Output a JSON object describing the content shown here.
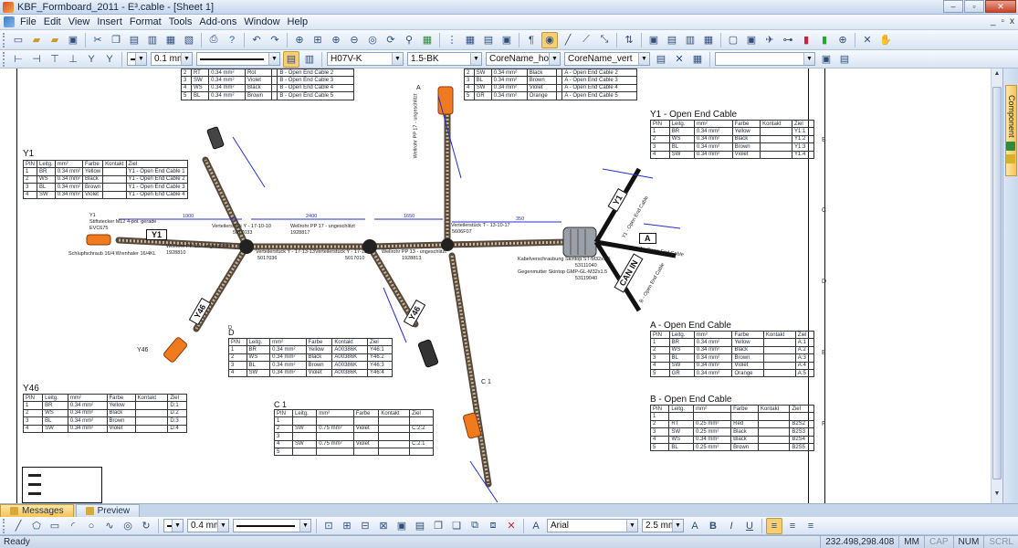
{
  "window": {
    "title": "KBF_Formboard_2011 - E³.cable - [Sheet 1]",
    "minimize": "–",
    "restore": "▫",
    "close": "✕"
  },
  "menu": {
    "items": [
      "File",
      "Edit",
      "View",
      "Insert",
      "Format",
      "Tools",
      "Add-ons",
      "Window",
      "Help"
    ],
    "mdi": [
      "_",
      "▫",
      "x"
    ]
  },
  "toolbar2": {
    "line_width": "0.1 mm",
    "cable_type": "H07V-K",
    "cable_section": "1.5-BK",
    "core_name_h": "CoreName_hori",
    "core_name_v": "CoreName_vert",
    "empty_combo": ""
  },
  "drawing": {
    "row_letters": [
      "B",
      "C",
      "D",
      "E",
      "F"
    ],
    "tables": {
      "header": [
        "PIN",
        "Leitg.",
        "mm²",
        "Farbe",
        "Kontakt",
        "Ziel"
      ],
      "top_left_partial": [
        [
          "2",
          "RT",
          "0.34 mm²",
          "Rot",
          "",
          "B - Open End Cable 2"
        ],
        [
          "3",
          "SW",
          "0.34 mm²",
          "Violet",
          "",
          "B - Open End Cable 3"
        ],
        [
          "4",
          "WS",
          "0.34 mm²",
          "Black",
          "",
          "B - Open End Cable 4"
        ],
        [
          "5",
          "BL",
          "0.34 mm²",
          "Brown",
          "",
          "B - Open End Cable 5"
        ]
      ],
      "top_mid_partial": [
        [
          "2",
          "SW",
          "0.34 mm²",
          "Black",
          "",
          "A - Open End Cable 2"
        ],
        [
          "3",
          "BL",
          "0.34 mm²",
          "Brown",
          "",
          "A - Open End Cable 3"
        ],
        [
          "4",
          "SW",
          "0.34 mm²",
          "Violet",
          "",
          "A - Open End Cable 4"
        ],
        [
          "5",
          "GR",
          "0.34 mm²",
          "Orange",
          "",
          "A - Open End Cable 5"
        ]
      ],
      "y1_left": {
        "title": "Y1",
        "rows": [
          [
            "1",
            "BR",
            "0.34 mm²",
            "Yellow",
            "",
            "Y1 - Open End Cable 1"
          ],
          [
            "2",
            "WS",
            "0.34 mm²",
            "Black",
            "",
            "Y1 - Open End Cable 2"
          ],
          [
            "3",
            "BL",
            "0.34 mm²",
            "Brown",
            "",
            "Y1 - Open End Cable 3"
          ],
          [
            "4",
            "SW",
            "0.34 mm²",
            "Violet",
            "",
            "Y1 - Open End Cable 4"
          ]
        ]
      },
      "y1_right": {
        "title": "Y1 - Open End Cable",
        "rows": [
          [
            "1",
            "BR",
            "0.34 mm²",
            "Yellow",
            "",
            "Y1:1"
          ],
          [
            "2",
            "WS",
            "0.34 mm²",
            "Black",
            "",
            "Y1:2"
          ],
          [
            "3",
            "BL",
            "0.34 mm²",
            "Brown",
            "",
            "Y1:3"
          ],
          [
            "4",
            "SW",
            "0.34 mm²",
            "Violet",
            "",
            "Y1:4"
          ]
        ]
      },
      "d": {
        "title": "D",
        "header": [
          "PIN",
          "Leitg.",
          "mm²",
          "Farbe",
          "Kontakt",
          "Ziel"
        ],
        "rows": [
          [
            "1",
            "BR",
            "0.34 mm²",
            "Yellow",
            "A00386K",
            "Y46:1"
          ],
          [
            "2",
            "WS",
            "0.34 mm²",
            "Black",
            "A00386K",
            "Y46:2"
          ],
          [
            "3",
            "BL",
            "0.34 mm²",
            "Brown",
            "A00386K",
            "Y46:3"
          ],
          [
            "4",
            "SW",
            "0.34 mm²",
            "Violet",
            "A00386K",
            "Y46:4"
          ]
        ]
      },
      "y46": {
        "title": "Y46",
        "rows": [
          [
            "1",
            "BR",
            "0.34 mm²",
            "Yellow",
            "",
            "D:1"
          ],
          [
            "2",
            "WS",
            "0.34 mm²",
            "Black",
            "",
            "D:2"
          ],
          [
            "3",
            "BL",
            "0.34 mm²",
            "Brown",
            "",
            "D:3"
          ],
          [
            "4",
            "SW",
            "0.34 mm²",
            "Violet",
            "",
            "D:4"
          ]
        ]
      },
      "c1": {
        "title": "C 1",
        "rows": [
          [
            "1",
            "",
            "",
            "",
            "",
            ""
          ],
          [
            "2",
            "SW",
            "0.75 mm²",
            "Violet",
            "",
            "C:2:2"
          ],
          [
            "3",
            "",
            "",
            "",
            "",
            ""
          ],
          [
            "4",
            "SW",
            "0.75 mm²",
            "Violet",
            "",
            "C:2:1"
          ],
          [
            "5",
            "",
            "",
            "",
            "",
            ""
          ]
        ]
      },
      "a": {
        "title": "A - Open End Cable",
        "rows": [
          [
            "1",
            "BR",
            "0.34 mm²",
            "Yellow",
            "",
            "A:1"
          ],
          [
            "2",
            "WS",
            "0.34 mm²",
            "Black",
            "",
            "A:2"
          ],
          [
            "3",
            "BL",
            "0.34 mm²",
            "Brown",
            "",
            "A:3"
          ],
          [
            "4",
            "SW",
            "0.34 mm²",
            "Violet",
            "",
            "A:4"
          ],
          [
            "5",
            "GR",
            "0.34 mm²",
            "Orange",
            "",
            "A:5"
          ]
        ]
      },
      "b": {
        "title": "B - Open End Cable",
        "rows": [
          [
            "1",
            "",
            "",
            "",
            "",
            ""
          ],
          [
            "2",
            "RT",
            "0.25 mm²",
            "Red",
            "",
            "B2S2"
          ],
          [
            "3",
            "SW",
            "0.25 mm²",
            "Black",
            "",
            "B2S3"
          ],
          [
            "4",
            "WS",
            "0.34 mm²",
            "Black",
            "",
            "B2S4"
          ],
          [
            "5",
            "BL",
            "0.25 mm²",
            "Brown",
            "",
            "B2S5"
          ]
        ]
      }
    },
    "labels": {
      "y1_box": "Y1",
      "a_box": "A",
      "y46_box": "Y46",
      "can_in": "CAN IN",
      "y1_conn": "Y1",
      "y1_conn_sub": "Stiftstecker M12 4-pol. gerade",
      "y1_part": "EVC675",
      "y1_screw": "Schlupfschraub 16/4 Wrenhaler 16/4KL",
      "dist1": "1000",
      "dist2": "2400",
      "dist3": "1650",
      "dist4": "350",
      "split1": "Verteilerstück Y - 17-10-10",
      "split1_part": "5017033",
      "split2": "Verteilerstück Y - 17-13-13",
      "split2_part": "5017036",
      "split3": "Verteilerstück Y - 17-13-10",
      "split3_part": "5017010",
      "split4": "Verteilerstück T - 13-10-17",
      "split4_part": "5606F07",
      "wellrohr1": "Wellrohr PP 17 - ungeschlitzt",
      "wellrohr1_part": "1928817",
      "wellrohr2": "Wellrohr PP 10 - ungeschlitzt",
      "wellrohr2_part": "1928810",
      "wellrohr3": "Wellrohr PP 13 - ungeschlitzt",
      "wellrohr3_part": "1928813",
      "wellrohr4": "Wellrohr PP 17 - ungeschlitzt",
      "wellrohr4_part": "1928817",
      "gland1": "Kabelverschraubung Skintop ST-M32x1.5",
      "gland1_part": "53111040",
      "gland2": "Gegenmutter Skintop GMP-GL-M32x1.5",
      "gland2_part": "53119040",
      "kabel": "Kabel",
      "y1_open": "Y1 - Open End Cable",
      "a_open": "A - Open End Cable",
      "b_open": "B - Open End Cable",
      "y46_conn": "Y46",
      "c1_conn": "C 1",
      "a_conn": "A",
      "d_conn": "D"
    }
  },
  "bottom_tabs": [
    "Messages",
    "Preview"
  ],
  "toolbar3": {
    "line_width": "0.4 mm",
    "font": "Arial",
    "font_size": "2.5 mm"
  },
  "status": {
    "left": "Ready",
    "coords": "232.498,298.408",
    "mode": "MM",
    "cap": "CAP",
    "num": "NUM",
    "scrl": "SCRL"
  }
}
